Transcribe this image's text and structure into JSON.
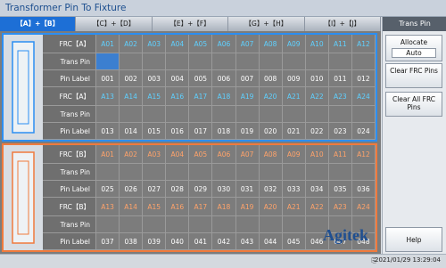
{
  "title": "Transformer Pin To Fixture",
  "tabs": [
    "【A】+【B】",
    "【C】+【D】",
    "【E】+【F】",
    "【G】+【H】",
    "【I】+【J】"
  ],
  "sidebar": {
    "header": "Trans Pin",
    "allocate": "Allocate",
    "auto": "Auto",
    "clear_frc": "Clear FRC Pins",
    "clear_all": "Clear All FRC Pins",
    "help": "Help"
  },
  "rows": {
    "blue": [
      {
        "label": "FRC【A】",
        "cells": [
          "A01",
          "A02",
          "A03",
          "A04",
          "A05",
          "A06",
          "A07",
          "A08",
          "A09",
          "A10",
          "A11",
          "A12"
        ]
      },
      {
        "label": "Trans Pin",
        "cells": [
          "",
          "",
          "",
          "",
          "",
          "",
          "",
          "",
          "",
          "",
          "",
          ""
        ]
      },
      {
        "label": "Pin Label",
        "cells": [
          "001",
          "002",
          "003",
          "004",
          "005",
          "006",
          "007",
          "008",
          "009",
          "010",
          "011",
          "012"
        ]
      },
      {
        "label": "FRC【A】",
        "cells": [
          "A13",
          "A14",
          "A15",
          "A16",
          "A17",
          "A18",
          "A19",
          "A20",
          "A21",
          "A22",
          "A23",
          "A24"
        ]
      },
      {
        "label": "Trans Pin",
        "cells": [
          "",
          "",
          "",
          "",
          "",
          "",
          "",
          "",
          "",
          "",
          "",
          ""
        ]
      },
      {
        "label": "Pin Label",
        "cells": [
          "013",
          "014",
          "015",
          "016",
          "017",
          "018",
          "019",
          "020",
          "021",
          "022",
          "023",
          "024"
        ]
      }
    ],
    "orange": [
      {
        "label": "FRC【B】",
        "cells": [
          "A01",
          "A02",
          "A03",
          "A04",
          "A05",
          "A06",
          "A07",
          "A08",
          "A09",
          "A10",
          "A11",
          "A12"
        ]
      },
      {
        "label": "Trans Pin",
        "cells": [
          "",
          "",
          "",
          "",
          "",
          "",
          "",
          "",
          "",
          "",
          "",
          ""
        ]
      },
      {
        "label": "Pin Label",
        "cells": [
          "025",
          "026",
          "027",
          "028",
          "029",
          "030",
          "031",
          "032",
          "033",
          "034",
          "035",
          "036"
        ]
      },
      {
        "label": "FRC【B】",
        "cells": [
          "A13",
          "A14",
          "A15",
          "A16",
          "A17",
          "A18",
          "A19",
          "A20",
          "A21",
          "A22",
          "A23",
          "A24"
        ]
      },
      {
        "label": "Trans Pin",
        "cells": [
          "",
          "",
          "",
          "",
          "",
          "",
          "",
          "",
          "",
          "",
          "",
          ""
        ]
      },
      {
        "label": "Pin Label",
        "cells": [
          "037",
          "038",
          "039",
          "040",
          "041",
          "042",
          "043",
          "044",
          "045",
          "046",
          "047",
          "048"
        ]
      }
    ]
  },
  "status": {
    "datetime": "2021/01/29 13:29:04"
  },
  "brand": "Agitek"
}
